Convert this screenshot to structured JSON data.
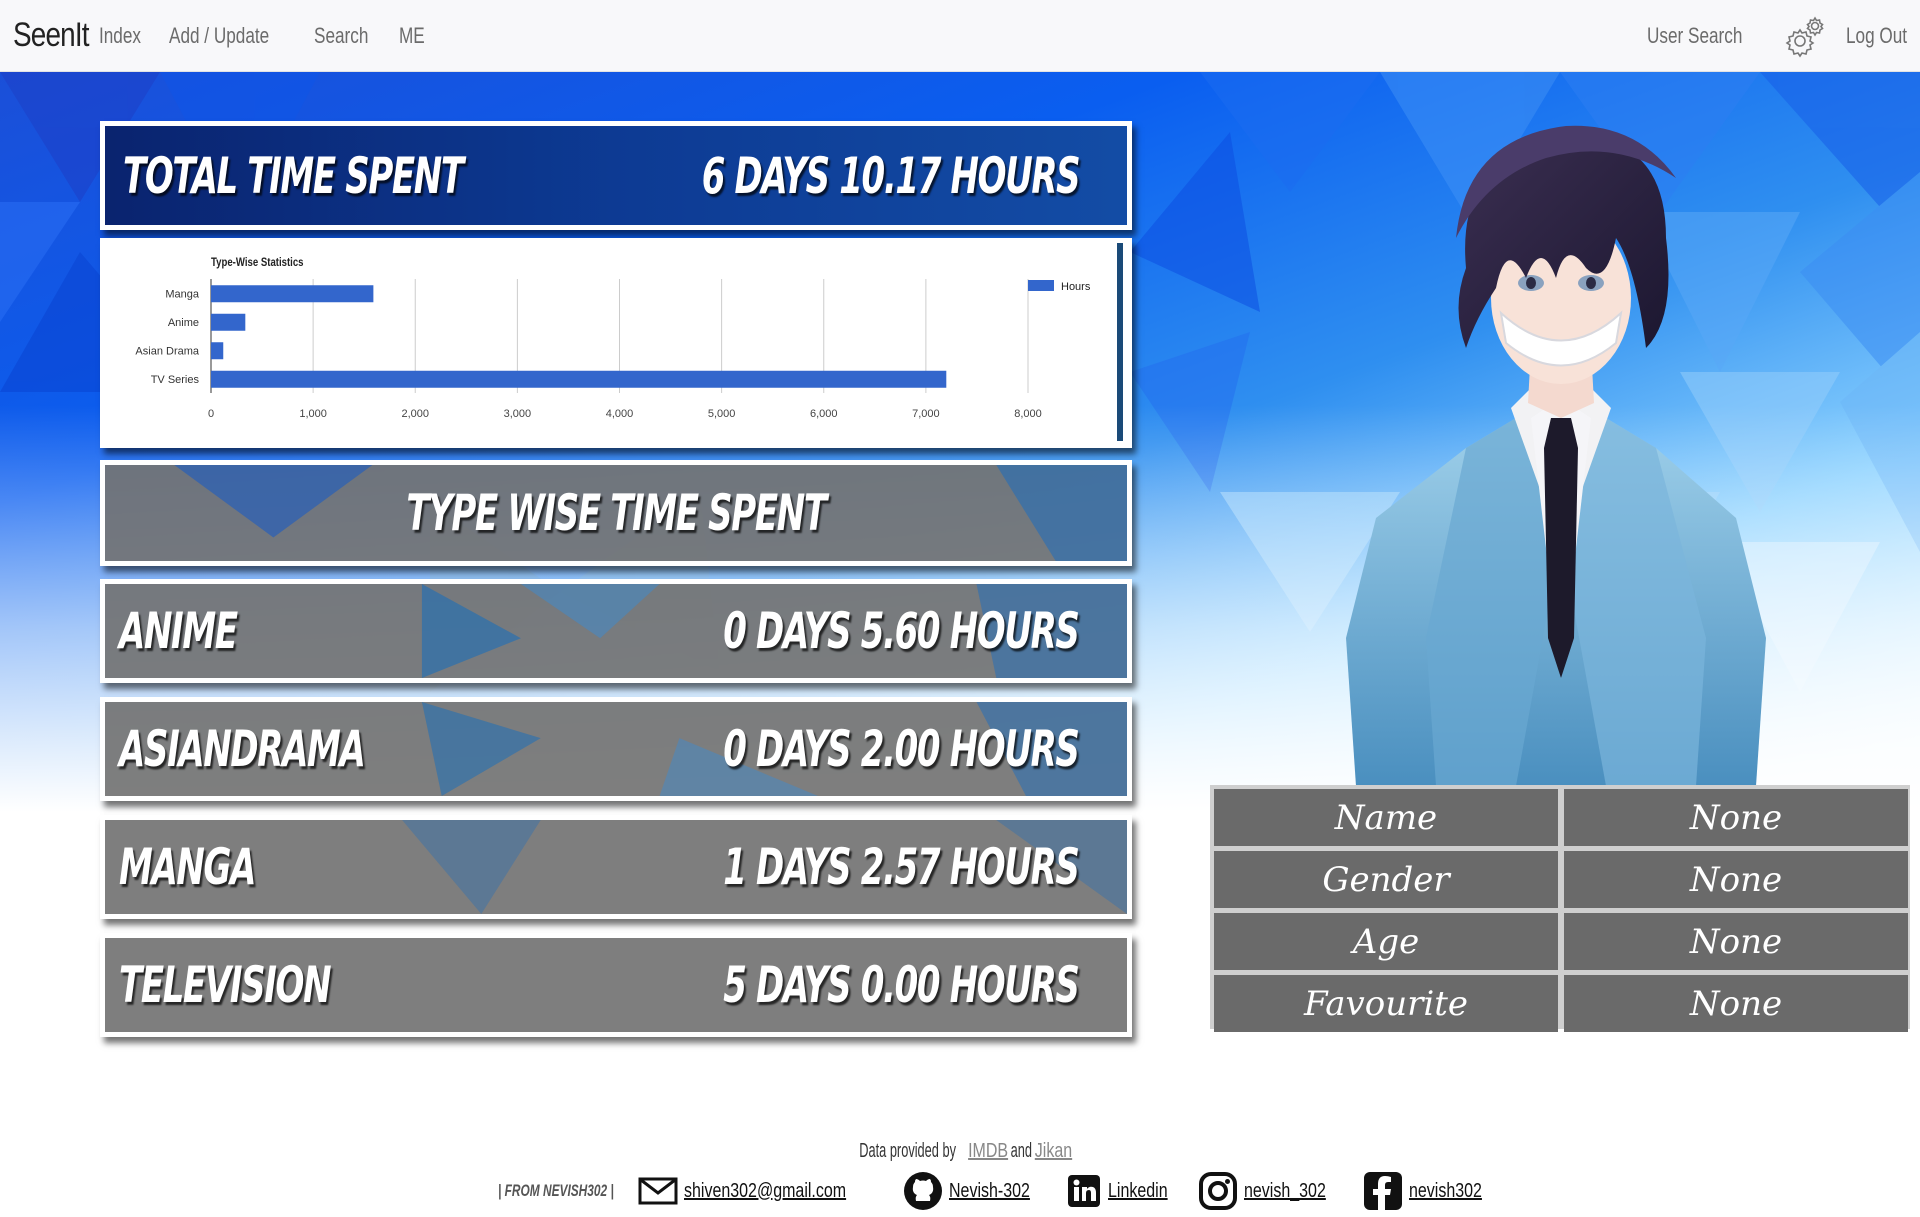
{
  "navbar": {
    "brand": "SeenIt",
    "links": [
      "Index",
      "Add / Update",
      "Search",
      "ME"
    ],
    "user_search": "User Search",
    "logout": "Log Out"
  },
  "total": {
    "label": "Total Time Spent",
    "value": "6 Days 10.17 Hours"
  },
  "section_title": "Type Wise Time Spent",
  "rows": [
    {
      "label": "Anime",
      "value": "0 Days 5.60 Hours"
    },
    {
      "label": "AsianDrama",
      "value": "0 Days 2.00 Hours"
    },
    {
      "label": "Manga",
      "value": "1 Days 2.57 Hours"
    },
    {
      "label": "Television",
      "value": "5 Days 0.00 Hours"
    }
  ],
  "chart_data": {
    "type": "bar",
    "orientation": "horizontal",
    "title": "Type-Wise Statistics",
    "categories": [
      "Manga",
      "Anime",
      "Asian Drama",
      "TV Series"
    ],
    "series": [
      {
        "name": "Hours",
        "values": [
          1590,
          336,
          120,
          7200
        ],
        "color": "#3366cc"
      }
    ],
    "xlim": [
      0,
      8000
    ],
    "ticks": [
      "0",
      "1,000",
      "2,000",
      "3,000",
      "4,000",
      "5,000",
      "6,000",
      "7,000",
      "8,000"
    ],
    "grid": true,
    "legend": "top-right"
  },
  "profile": [
    {
      "key": "Name",
      "value": "None"
    },
    {
      "key": "Gender",
      "value": "None"
    },
    {
      "key": "Age",
      "value": "None"
    },
    {
      "key": "Favourite",
      "value": "None"
    }
  ],
  "footer": {
    "data_prefix": "Data provided by ",
    "imdb": "IMDB",
    "and": "and",
    "jikan": "Jikan",
    "from": "| FROM NEVISH302 |",
    "email": "shiven302@gmail.com",
    "github": "Nevish-302",
    "linkedin": "Linkedin",
    "instagram": "nevish_302",
    "facebook": "nevish302"
  },
  "colors": {
    "bar": "#3366cc",
    "panel_grey": "#737373",
    "navy": "#0b2a7a"
  }
}
